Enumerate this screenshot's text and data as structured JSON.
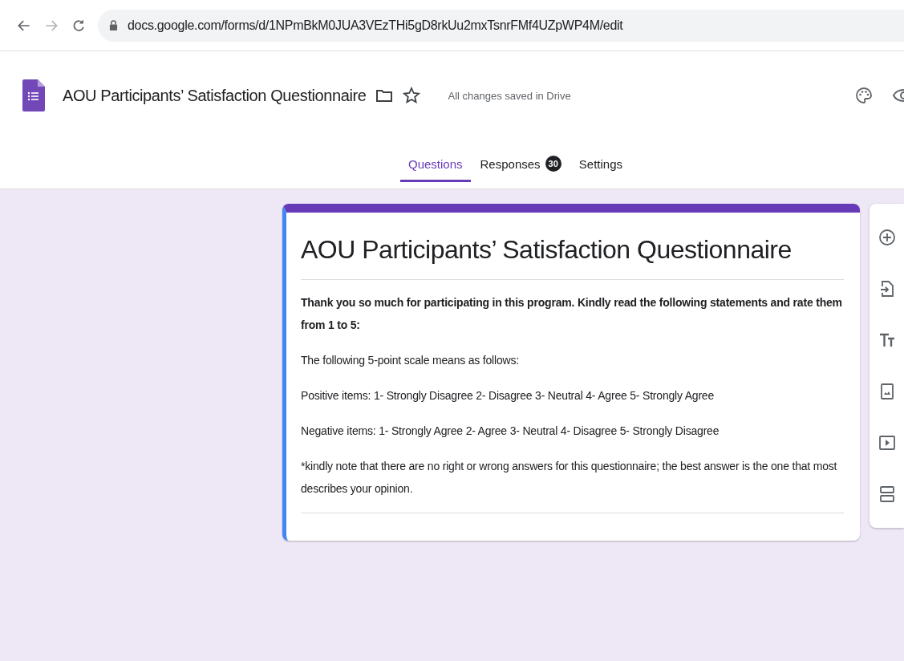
{
  "browser": {
    "url": "docs.google.com/forms/d/1NPmBkM0JUA3VEzTHi5gD8rkUu2mxTsnrFMf4UZpWP4M/edit"
  },
  "header": {
    "title": "AOU Participants’ Satisfaction Questionnaire",
    "save_status": "All changes saved in Drive"
  },
  "tabs": [
    {
      "label": "Questions",
      "selected": true
    },
    {
      "label": "Responses",
      "selected": false,
      "badge": "30"
    },
    {
      "label": "Settings",
      "selected": false
    }
  ],
  "form": {
    "title": "AOU Participants’ Satisfaction Questionnaire",
    "description": [
      {
        "text": "Thank you so much for participating in this program. Kindly read the following statements and rate them from 1 to 5:",
        "bold": true
      },
      {
        "text": "The following 5-point scale means as follows:",
        "bold": false
      },
      {
        "text": "Positive items: 1- Strongly Disagree 2- Disagree 3- Neutral  4- Agree 5- Strongly Agree",
        "bold": false
      },
      {
        "text": "Negative items: 1- Strongly Agree 2- Agree 3- Neutral  4- Disagree 5- Strongly Disagree",
        "bold": false
      },
      {
        "text": "*kindly note that there are no right or wrong answers for this questionnaire; the best answer is the one that most describes your opinion.",
        "bold": false
      }
    ]
  }
}
